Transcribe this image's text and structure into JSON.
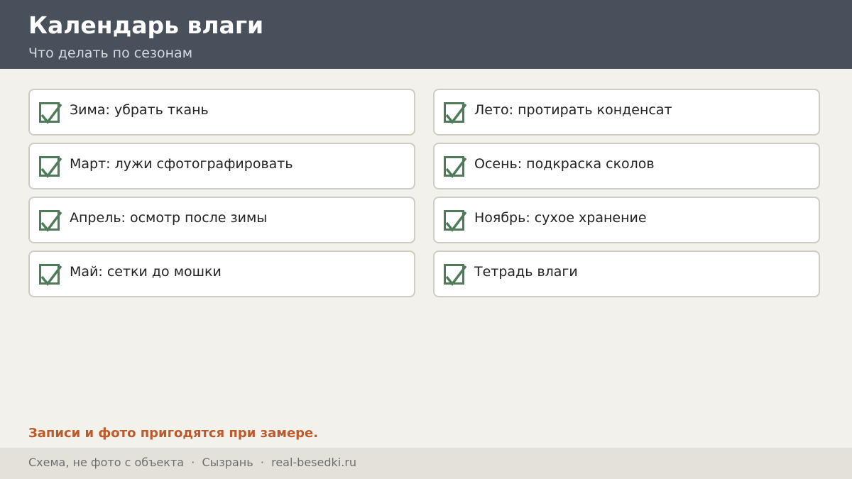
{
  "header": {
    "title": "Календарь влаги",
    "subtitle": "Что делать по сезонам"
  },
  "checklist": {
    "left": [
      {
        "label": "Зима: убрать ткань",
        "checked": true
      },
      {
        "label": "Март: лужи сфотографировать",
        "checked": true
      },
      {
        "label": "Апрель: осмотр после зимы",
        "checked": true
      },
      {
        "label": "Май: сетки до мошки",
        "checked": true
      }
    ],
    "right": [
      {
        "label": "Лето: протирать конденсат",
        "checked": true
      },
      {
        "label": "Осень: подкраска сколов",
        "checked": true
      },
      {
        "label": "Ноябрь: сухое хранение",
        "checked": true
      },
      {
        "label": "Тетрадь влаги",
        "checked": true
      }
    ]
  },
  "note": "Записи и фото пригодятся при замере.",
  "footer": {
    "text": "Схема, не фото с объекта  ·  Сызрань  ·  real-besedki.ru"
  },
  "colors": {
    "header_bg": "#48505c",
    "check": "#4e7c58",
    "accent": "#bd5a2b",
    "page_bg": "#f3f1ec",
    "footer_bg": "#e4e1da"
  }
}
